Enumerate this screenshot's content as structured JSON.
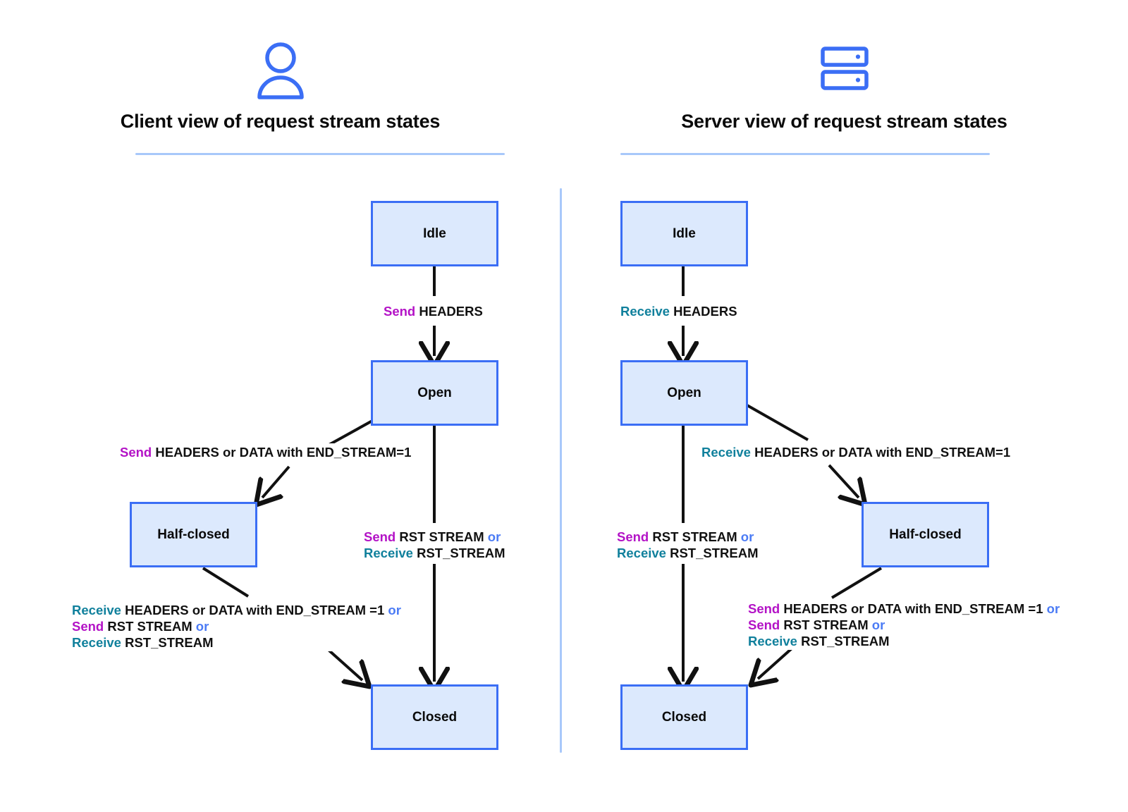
{
  "panels": [
    {
      "icon": "user-icon",
      "title": "Client view of request stream states",
      "nodes": [
        {
          "id": "idle",
          "label": "Idle"
        },
        {
          "id": "open",
          "label": "Open"
        },
        {
          "id": "half-closed",
          "label": "Half-closed"
        },
        {
          "id": "closed",
          "label": "Closed"
        }
      ],
      "transitions": {
        "idle_to_open": [
          {
            "text": "Send",
            "style": "send"
          },
          {
            "text": " HEADERS",
            "style": "plain"
          }
        ],
        "open_to_half": [
          {
            "text": "Send",
            "style": "send"
          },
          {
            "text": " HEADERS or DATA with END_STREAM=1",
            "style": "plain"
          }
        ],
        "open_to_closed": [
          {
            "text": "Send",
            "style": "send"
          },
          {
            "text": " RST STREAM ",
            "style": "plain"
          },
          {
            "text": "or",
            "style": "or"
          },
          {
            "text": "\n",
            "style": "break"
          },
          {
            "text": "Receive",
            "style": "recv"
          },
          {
            "text": " RST_STREAM",
            "style": "plain"
          }
        ],
        "half_to_closed": [
          {
            "text": "Receive",
            "style": "recv"
          },
          {
            "text": " HEADERS or DATA with END_STREAM =1  ",
            "style": "plain"
          },
          {
            "text": "or",
            "style": "or"
          },
          {
            "text": "\n",
            "style": "break"
          },
          {
            "text": "Send",
            "style": "send"
          },
          {
            "text": " RST STREAM  ",
            "style": "plain"
          },
          {
            "text": "or",
            "style": "or"
          },
          {
            "text": "\n",
            "style": "break"
          },
          {
            "text": "Receive",
            "style": "recv"
          },
          {
            "text": " RST_STREAM",
            "style": "plain"
          }
        ]
      }
    },
    {
      "icon": "server-icon",
      "title": "Server view of request stream states",
      "nodes": [
        {
          "id": "idle",
          "label": "Idle"
        },
        {
          "id": "open",
          "label": "Open"
        },
        {
          "id": "half-closed",
          "label": "Half-closed"
        },
        {
          "id": "closed",
          "label": "Closed"
        }
      ],
      "transitions": {
        "idle_to_open": [
          {
            "text": "Receive",
            "style": "recv"
          },
          {
            "text": " HEADERS",
            "style": "plain"
          }
        ],
        "open_to_half": [
          {
            "text": "Receive",
            "style": "recv"
          },
          {
            "text": " HEADERS or DATA with END_STREAM=1",
            "style": "plain"
          }
        ],
        "open_to_closed": [
          {
            "text": "Send",
            "style": "send"
          },
          {
            "text": " RST STREAM ",
            "style": "plain"
          },
          {
            "text": "or",
            "style": "or"
          },
          {
            "text": "\n",
            "style": "break"
          },
          {
            "text": "Receive",
            "style": "recv"
          },
          {
            "text": " RST_STREAM",
            "style": "plain"
          }
        ],
        "half_to_closed": [
          {
            "text": "Send",
            "style": "send"
          },
          {
            "text": " HEADERS or DATA with END_STREAM =1  ",
            "style": "plain"
          },
          {
            "text": "or",
            "style": "or"
          },
          {
            "text": "\n",
            "style": "break"
          },
          {
            "text": "Send",
            "style": "send"
          },
          {
            "text": " RST STREAM ",
            "style": "plain"
          },
          {
            "text": "or",
            "style": "or"
          },
          {
            "text": "\n",
            "style": "break"
          },
          {
            "text": "Receive",
            "style": "recv"
          },
          {
            "text": " RST_STREAM",
            "style": "plain"
          }
        ]
      }
    }
  ],
  "colors": {
    "box_fill": "#dce9fd",
    "box_border": "#3b6ef5",
    "send": "#b312c6",
    "receive": "#10809c",
    "or": "#4b7bf5",
    "rule": "#a8c8fa",
    "arrow": "#111111",
    "text": "#0a0a0a",
    "background": "#ffffff"
  }
}
